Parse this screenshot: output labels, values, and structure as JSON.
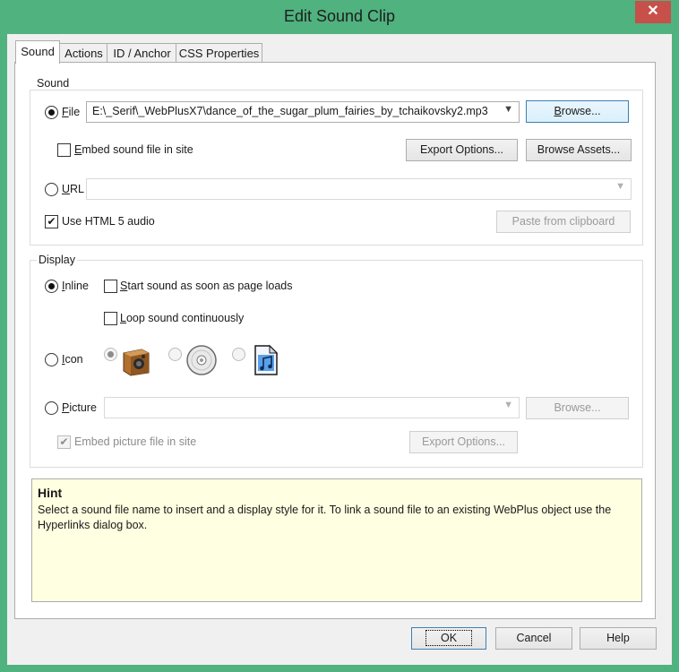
{
  "window": {
    "title": "Edit Sound Clip",
    "close_glyph": "✕"
  },
  "tabs": [
    {
      "label": "Sound",
      "active": true
    },
    {
      "label": "Actions",
      "active": false
    },
    {
      "label": "ID / Anchor",
      "active": false
    },
    {
      "label": "CSS Properties",
      "active": false
    }
  ],
  "sound_group": {
    "label": "Sound",
    "file_radio_label": "File",
    "file_path": "E:\\_Serif\\_WebPlusX7\\dance_of_the_sugar_plum_fairies_by_tchaikovsky2.mp3",
    "browse_label": "Browse...",
    "embed_label": "Embed sound file in site",
    "export_options_label": "Export Options...",
    "browse_assets_label": "Browse Assets...",
    "url_radio_label": "URL",
    "url_value": "",
    "html5_label": "Use HTML 5 audio",
    "paste_label": "Paste from clipboard"
  },
  "display_group": {
    "label": "Display",
    "inline_label": "Inline",
    "start_label": "Start sound as soon as page loads",
    "loop_label": "Loop sound continuously",
    "icon_label": "Icon",
    "icon_options": [
      "speaker-icon",
      "cd-disc-icon",
      "music-file-icon"
    ],
    "picture_label": "Picture",
    "picture_value": "",
    "picture_browse_label": "Browse...",
    "embed_picture_label": "Embed picture file in site",
    "export_options_label": "Export Options..."
  },
  "hint": {
    "title": "Hint",
    "body": "Select a sound file name to insert and a display style for it. To link a sound file to an existing WebPlus object use the Hyperlinks dialog box."
  },
  "footer": {
    "ok_label": "OK",
    "cancel_label": "Cancel",
    "help_label": "Help"
  },
  "colors": {
    "frame": "#4fb27f",
    "close": "#c7504a",
    "hint_bg": "#ffffe1"
  }
}
